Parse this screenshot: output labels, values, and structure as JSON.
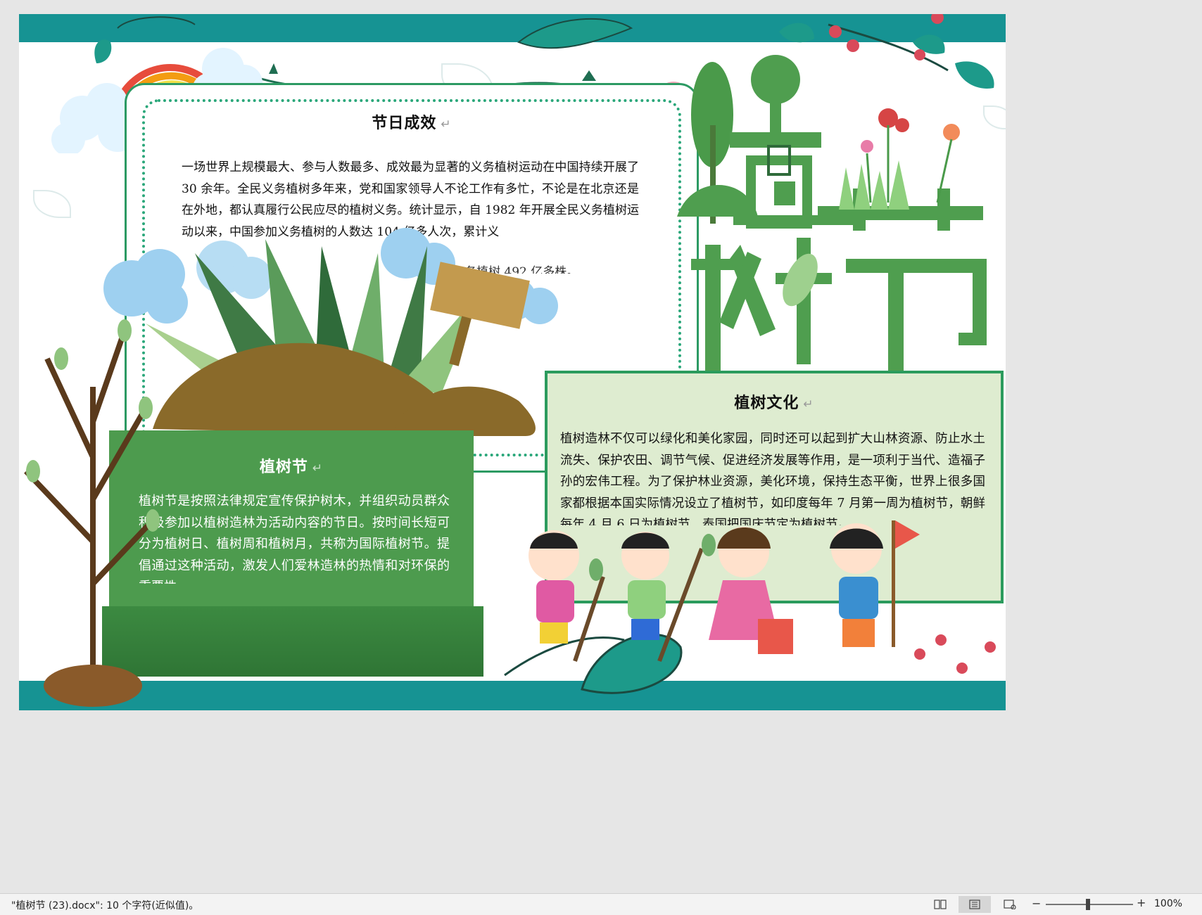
{
  "document": {
    "box1": {
      "title": "节日成效",
      "body": "一场世界上规模最大、参与人数最多、成效最为显著的义务植树运动在中国持续开展了 30 余年。全民义务植树多年来，党和国家领导人不论工作有多忙，不论是在北京还是在外地，都认真履行公民应尽的植树义务。统计显示，自 1982 年开展全民义务植树运动以来，中国参加义务植树的人数达 104 亿多人次，累计义",
      "tail": "务植树 492 亿多株。"
    },
    "box2": {
      "title": "植树文化",
      "body": "植树造林不仅可以绿化和美化家园，同时还可以起到扩大山林资源、防止水土流失、保护农田、调节气候、促进经济发展等作用，是一项利于当代、造福子孙的宏伟工程。为了保护林业资源，美化环境，保持生态平衡，世界上很多国家都根据本国实际情况设立了植树节，如印度每年 7 月第一周为植树节，朝鲜每年 4 月 6 日为植树节，泰国把国庆节定为植树节。"
    },
    "box3": {
      "title": "植树节",
      "body": "植树节是按照法律规定宣传保护树木，并组织动员群众积极参加以植树造林为活动内容的节日。按时间长短可分为植树日、植树周和植树月，共称为国际植树节。提倡通过这种活动，激发人们爱林造林的热情和对环保的重要性。"
    },
    "paragraph_mark": "↵",
    "headline_art": "植树节"
  },
  "statusbar": {
    "doc_status": "\"植树节 (23).docx\": 10 个字符(近似值)。",
    "zoom_level": "100%",
    "zoom_minus": "−",
    "zoom_plus": "+",
    "views": [
      "read-mode-icon",
      "print-layout-icon",
      "web-layout-icon"
    ],
    "active_view": "print-layout-icon"
  },
  "colors": {
    "teal_band": "#169393",
    "leaf_green": "#2c9a63",
    "title_green": "#4f9e4f",
    "box2_bg": "#deecd0",
    "box3_bg": "#4d9b4e",
    "workspace": "#e6e6e6"
  }
}
